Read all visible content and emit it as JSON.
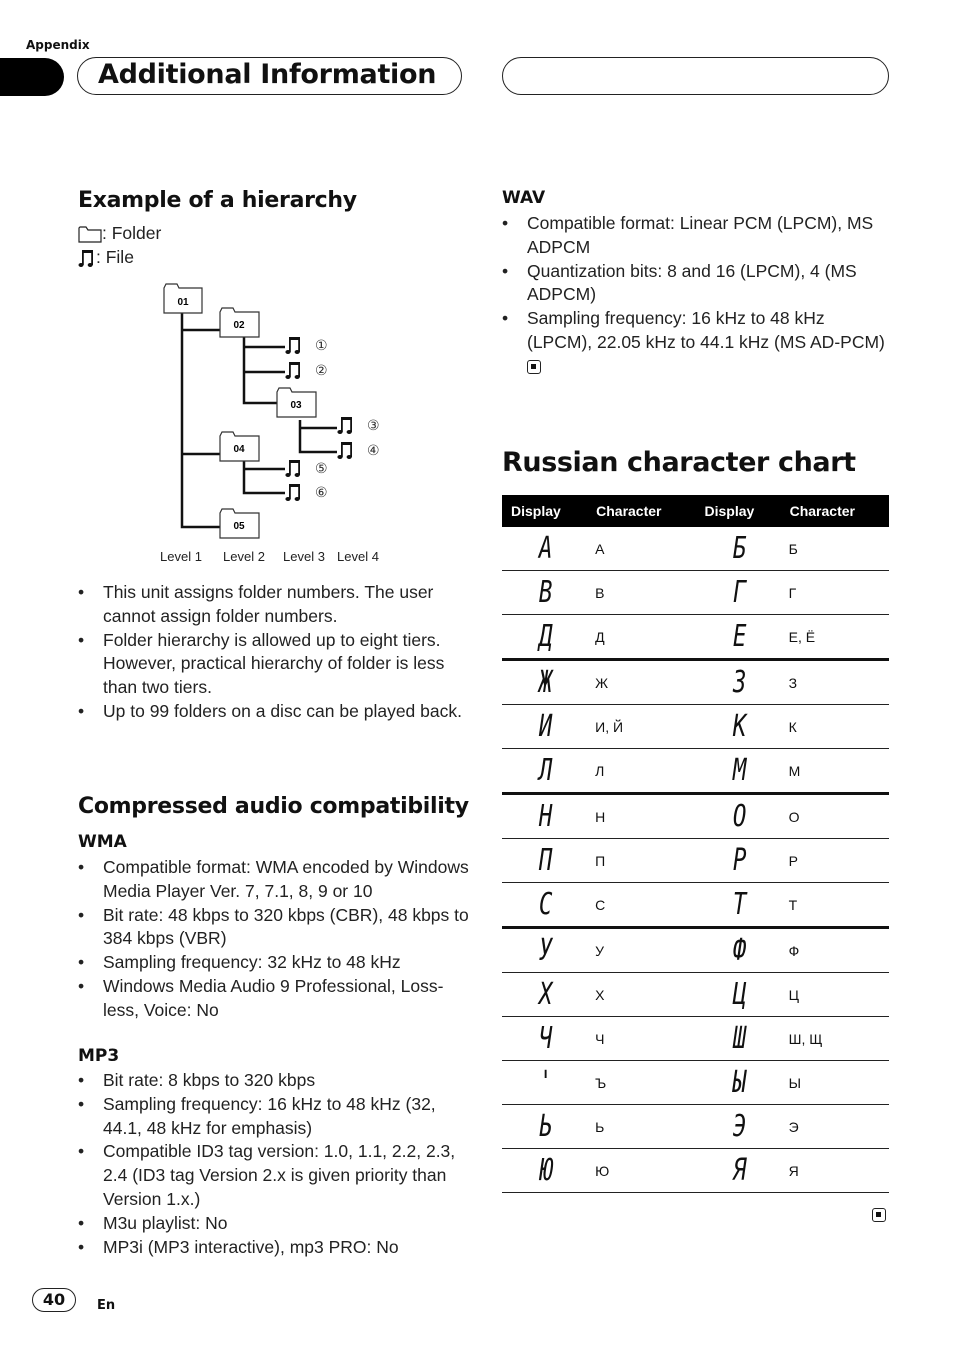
{
  "header": {
    "section": "Appendix",
    "title": "Additional Information"
  },
  "hierarchy": {
    "heading": "Example of a hierarchy",
    "legend_folder": ": Folder",
    "legend_file": ": File",
    "folders": [
      "01",
      "02",
      "03",
      "04",
      "05"
    ],
    "file_numbers": [
      "①",
      "②",
      "③",
      "④",
      "⑤",
      "⑥"
    ],
    "levels": [
      "Level 1",
      "Level 2",
      "Level 3",
      "Level 4"
    ],
    "bullets": [
      "This unit assigns folder numbers. The user cannot assign folder numbers.",
      "Folder hierarchy is allowed up to eight tiers. However, practical hierarchy of folder is less than two tiers.",
      "Up to 99 folders on a disc can be played back."
    ]
  },
  "compressed": {
    "heading": "Compressed audio compatibility",
    "wma": {
      "label": "WMA",
      "bullets": [
        "Compatible format: WMA encoded by Windows Media Player Ver. 7, 7.1, 8, 9 or 10",
        "Bit rate: 48 kbps to 320 kbps (CBR), 48 kbps to 384 kbps (VBR)",
        "Sampling frequency: 32 kHz to 48 kHz",
        "Windows Media Audio 9 Professional, Loss-less, Voice: No"
      ]
    },
    "mp3": {
      "label": "MP3",
      "bullets": [
        "Bit rate: 8 kbps to 320 kbps",
        "Sampling frequency: 16 kHz to 48 kHz (32, 44.1, 48 kHz for emphasis)",
        "Compatible ID3 tag version: 1.0, 1.1, 2.2, 2.3, 2.4 (ID3 tag Version 2.x is given priority than Version 1.x.)",
        "M3u playlist: No",
        "MP3i (MP3 interactive), mp3 PRO: No"
      ]
    },
    "wav": {
      "label": "WAV",
      "bullets": [
        "Compatible format: Linear PCM (LPCM), MS ADPCM",
        "Quantization bits: 8 and 16 (LPCM), 4 (MS ADPCM)",
        "Sampling frequency: 16 kHz to 48 kHz (LPCM), 22.05 kHz to 44.1 kHz (MS AD-PCM)"
      ]
    }
  },
  "russian_chart": {
    "heading": "Russian character chart",
    "columns": [
      "Display",
      "Character",
      "Display",
      "Character"
    ],
    "rows": [
      {
        "d1": "A",
        "c1": "А",
        "d2": "Б",
        "c2": "Б"
      },
      {
        "d1": "B",
        "c1": "В",
        "d2": "Г",
        "c2": "Г"
      },
      {
        "d1": "Д",
        "c1": "Д",
        "d2": "E",
        "c2": "Е, Ё"
      },
      {
        "d1": "Ж",
        "c1": "Ж",
        "d2": "З",
        "c2": "З"
      },
      {
        "d1": "И",
        "c1": "И, Й",
        "d2": "К",
        "c2": "К"
      },
      {
        "d1": "Л",
        "c1": "Л",
        "d2": "M",
        "c2": "М"
      },
      {
        "d1": "H",
        "c1": "Н",
        "d2": "O",
        "c2": "О"
      },
      {
        "d1": "П",
        "c1": "П",
        "d2": "P",
        "c2": "Р"
      },
      {
        "d1": "C",
        "c1": "С",
        "d2": "T",
        "c2": "Т"
      },
      {
        "d1": "У",
        "c1": "У",
        "d2": "Ф",
        "c2": "Ф"
      },
      {
        "d1": "X",
        "c1": "Х",
        "d2": "Ц",
        "c2": "Ц"
      },
      {
        "d1": "Ч",
        "c1": "Ч",
        "d2": "Ш",
        "c2": "Ш, Щ"
      },
      {
        "d1": "'",
        "c1": "Ъ",
        "d2": "Ы",
        "c2": "Ы"
      },
      {
        "d1": "Ь",
        "c1": "Ь",
        "d2": "Э",
        "c2": "Э"
      },
      {
        "d1": "Ю",
        "c1": "Ю",
        "d2": "Я",
        "c2": "Я"
      }
    ]
  },
  "footer": {
    "page_number": "40",
    "language": "En"
  }
}
